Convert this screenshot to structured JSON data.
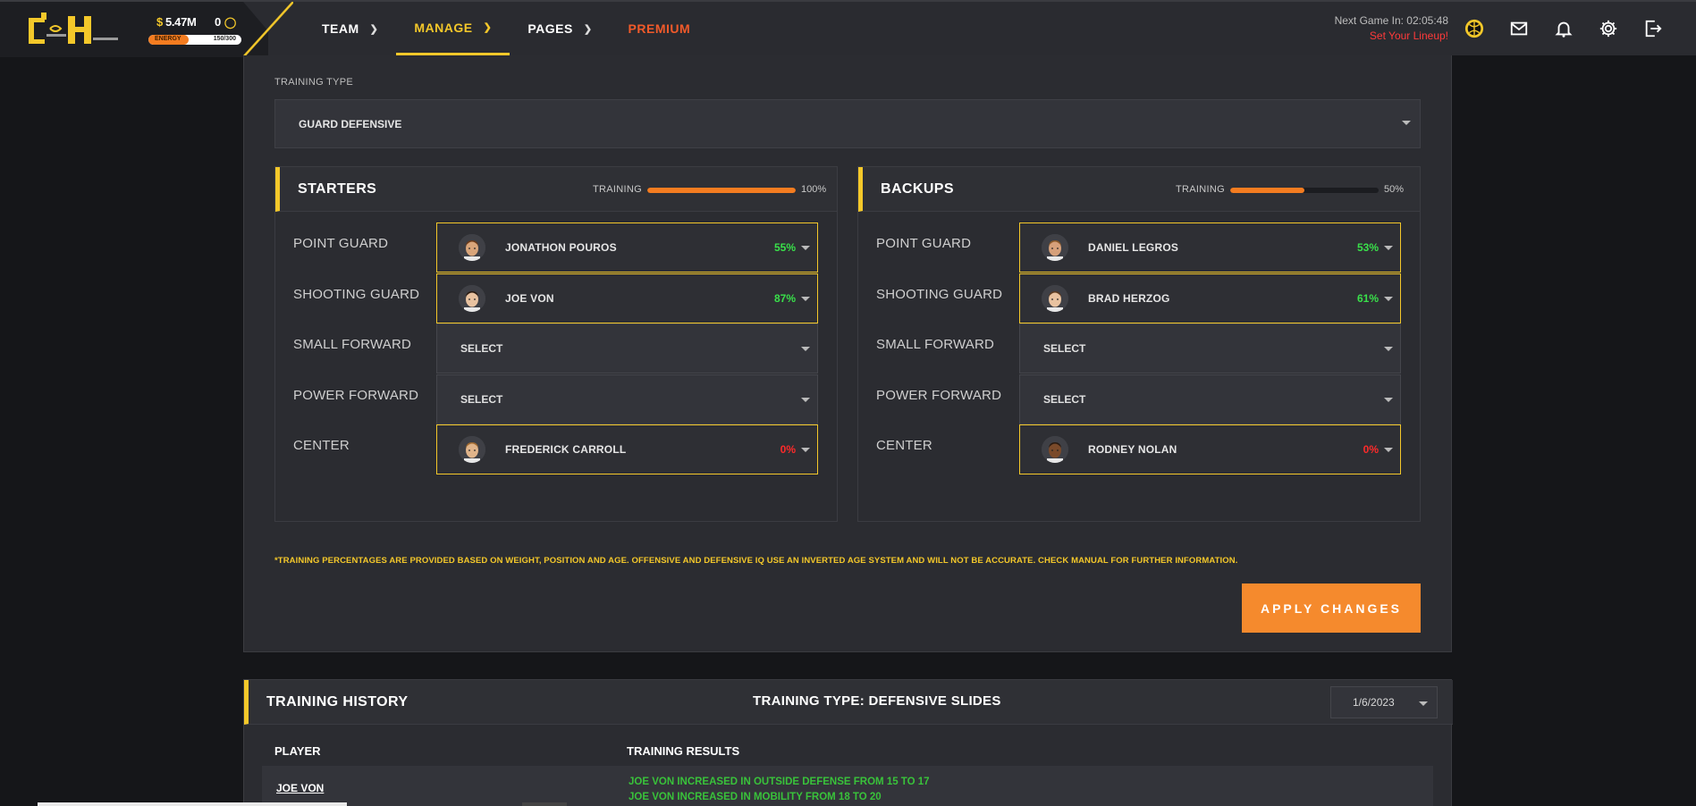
{
  "header": {
    "money": "5.47M",
    "money_symbol": "$",
    "coins": "0",
    "energy_label": "ENERGY",
    "energy_value": "150/300",
    "energy_fraction": 0.43,
    "nav": [
      {
        "label": "TEAM"
      },
      {
        "label": "MANAGE"
      },
      {
        "label": "PAGES"
      },
      {
        "label": "PREMIUM"
      }
    ],
    "next_game": "Next Game In: 02:05:48",
    "set_lineup": "Set Your Lineup!",
    "icons": [
      "team-logo-icon",
      "mail-icon",
      "bell-icon",
      "gear-icon",
      "logout-icon"
    ]
  },
  "training": {
    "type_label": "TRAINING TYPE",
    "type_value": "GUARD DEFENSIVE",
    "starters": {
      "title": "STARTERS",
      "training_label": "TRAINING",
      "training_pct": "100%",
      "training_fraction": 1.0,
      "rows": [
        {
          "position": "POINT GUARD",
          "player": "JONATHON POUROS",
          "pct": "55%"
        },
        {
          "position": "SHOOTING GUARD",
          "player": "JOE VON",
          "pct": "87%"
        },
        {
          "position": "SMALL FORWARD",
          "player": "SELECT",
          "pct": ""
        },
        {
          "position": "POWER FORWARD",
          "player": "SELECT",
          "pct": ""
        },
        {
          "position": "CENTER",
          "player": "FREDERICK CARROLL",
          "pct": "0%"
        }
      ]
    },
    "backups": {
      "title": "BACKUPS",
      "training_label": "TRAINING",
      "training_pct": "50%",
      "training_fraction": 0.5,
      "rows": [
        {
          "position": "POINT GUARD",
          "player": "DANIEL LEGROS",
          "pct": "53%"
        },
        {
          "position": "SHOOTING GUARD",
          "player": "BRAD HERZOG",
          "pct": "61%"
        },
        {
          "position": "SMALL FORWARD",
          "player": "SELECT",
          "pct": ""
        },
        {
          "position": "POWER FORWARD",
          "player": "SELECT",
          "pct": ""
        },
        {
          "position": "CENTER",
          "player": "RODNEY NOLAN",
          "pct": "0%"
        }
      ]
    },
    "note": "*TRAINING PERCENTAGES ARE PROVIDED BASED ON WEIGHT, POSITION AND AGE. OFFENSIVE AND DEFENSIVE IQ USE AN INVERTED AGE SYSTEM AND WILL NOT BE ACCURATE. CHECK MANUAL FOR FURTHER INFORMATION.",
    "apply_label": "APPLY CHANGES"
  },
  "history": {
    "title": "TRAINING HISTORY",
    "type": "TRAINING TYPE: DEFENSIVE SLIDES",
    "date": "1/6/2023",
    "col_player": "PLAYER",
    "col_results": "TRAINING RESULTS",
    "rows": [
      {
        "player": "JOE VON",
        "results": [
          "JOE VON INCREASED IN OUTSIDE DEFENSE FROM 15 TO 17",
          "JOE VON INCREASED IN MOBILITY FROM 18 TO 20"
        ]
      }
    ]
  },
  "colors": {
    "accent_yellow": "#f4c82a",
    "accent_orange": "#f58a2d",
    "positive": "#39e04a",
    "negative": "#ff2a2a"
  }
}
